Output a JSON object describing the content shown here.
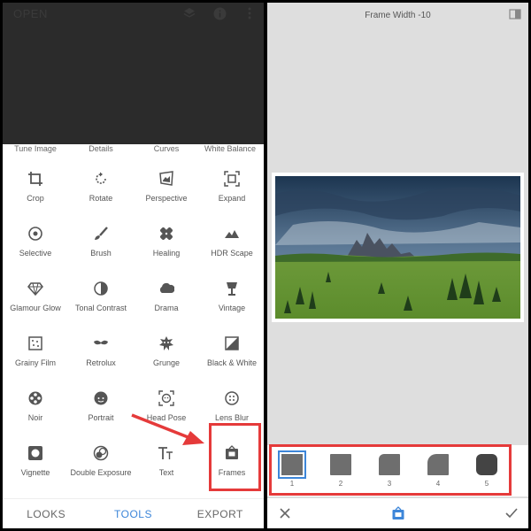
{
  "left": {
    "open_label": "OPEN",
    "partial_tools": [
      {
        "label": "Tune Image"
      },
      {
        "label": "Details"
      },
      {
        "label": "Curves"
      },
      {
        "label": "White Balance"
      }
    ],
    "tools": [
      {
        "label": "Crop",
        "icon": "crop-icon"
      },
      {
        "label": "Rotate",
        "icon": "rotate-icon"
      },
      {
        "label": "Perspective",
        "icon": "perspective-icon"
      },
      {
        "label": "Expand",
        "icon": "expand-icon"
      },
      {
        "label": "Selective",
        "icon": "selective-icon"
      },
      {
        "label": "Brush",
        "icon": "brush-icon"
      },
      {
        "label": "Healing",
        "icon": "healing-icon"
      },
      {
        "label": "HDR Scape",
        "icon": "hdr-scape-icon"
      },
      {
        "label": "Glamour Glow",
        "icon": "glamour-glow-icon"
      },
      {
        "label": "Tonal Contrast",
        "icon": "tonal-contrast-icon"
      },
      {
        "label": "Drama",
        "icon": "drama-icon"
      },
      {
        "label": "Vintage",
        "icon": "vintage-icon"
      },
      {
        "label": "Grainy Film",
        "icon": "grainy-film-icon"
      },
      {
        "label": "Retrolux",
        "icon": "retrolux-icon"
      },
      {
        "label": "Grunge",
        "icon": "grunge-icon"
      },
      {
        "label": "Black & White",
        "icon": "black-white-icon"
      },
      {
        "label": "Noir",
        "icon": "noir-icon"
      },
      {
        "label": "Portrait",
        "icon": "portrait-icon"
      },
      {
        "label": "Head Pose",
        "icon": "head-pose-icon"
      },
      {
        "label": "Lens Blur",
        "icon": "lens-blur-icon"
      },
      {
        "label": "Vignette",
        "icon": "vignette-icon"
      },
      {
        "label": "Double Exposure",
        "icon": "double-exposure-icon"
      },
      {
        "label": "Text",
        "icon": "text-icon"
      },
      {
        "label": "Frames",
        "icon": "frames-icon"
      }
    ],
    "tabs": [
      {
        "label": "LOOKS",
        "active": false
      },
      {
        "label": "TOOLS",
        "active": true
      },
      {
        "label": "EXPORT",
        "active": false
      }
    ]
  },
  "right": {
    "title": "Frame Width -10",
    "frames": [
      {
        "num": "1",
        "selected": true
      },
      {
        "num": "2",
        "selected": false
      },
      {
        "num": "3",
        "selected": false
      },
      {
        "num": "4",
        "selected": false
      },
      {
        "num": "5",
        "selected": false
      }
    ]
  },
  "colors": {
    "accent": "#3d86d9",
    "highlight": "#e53a3a"
  }
}
